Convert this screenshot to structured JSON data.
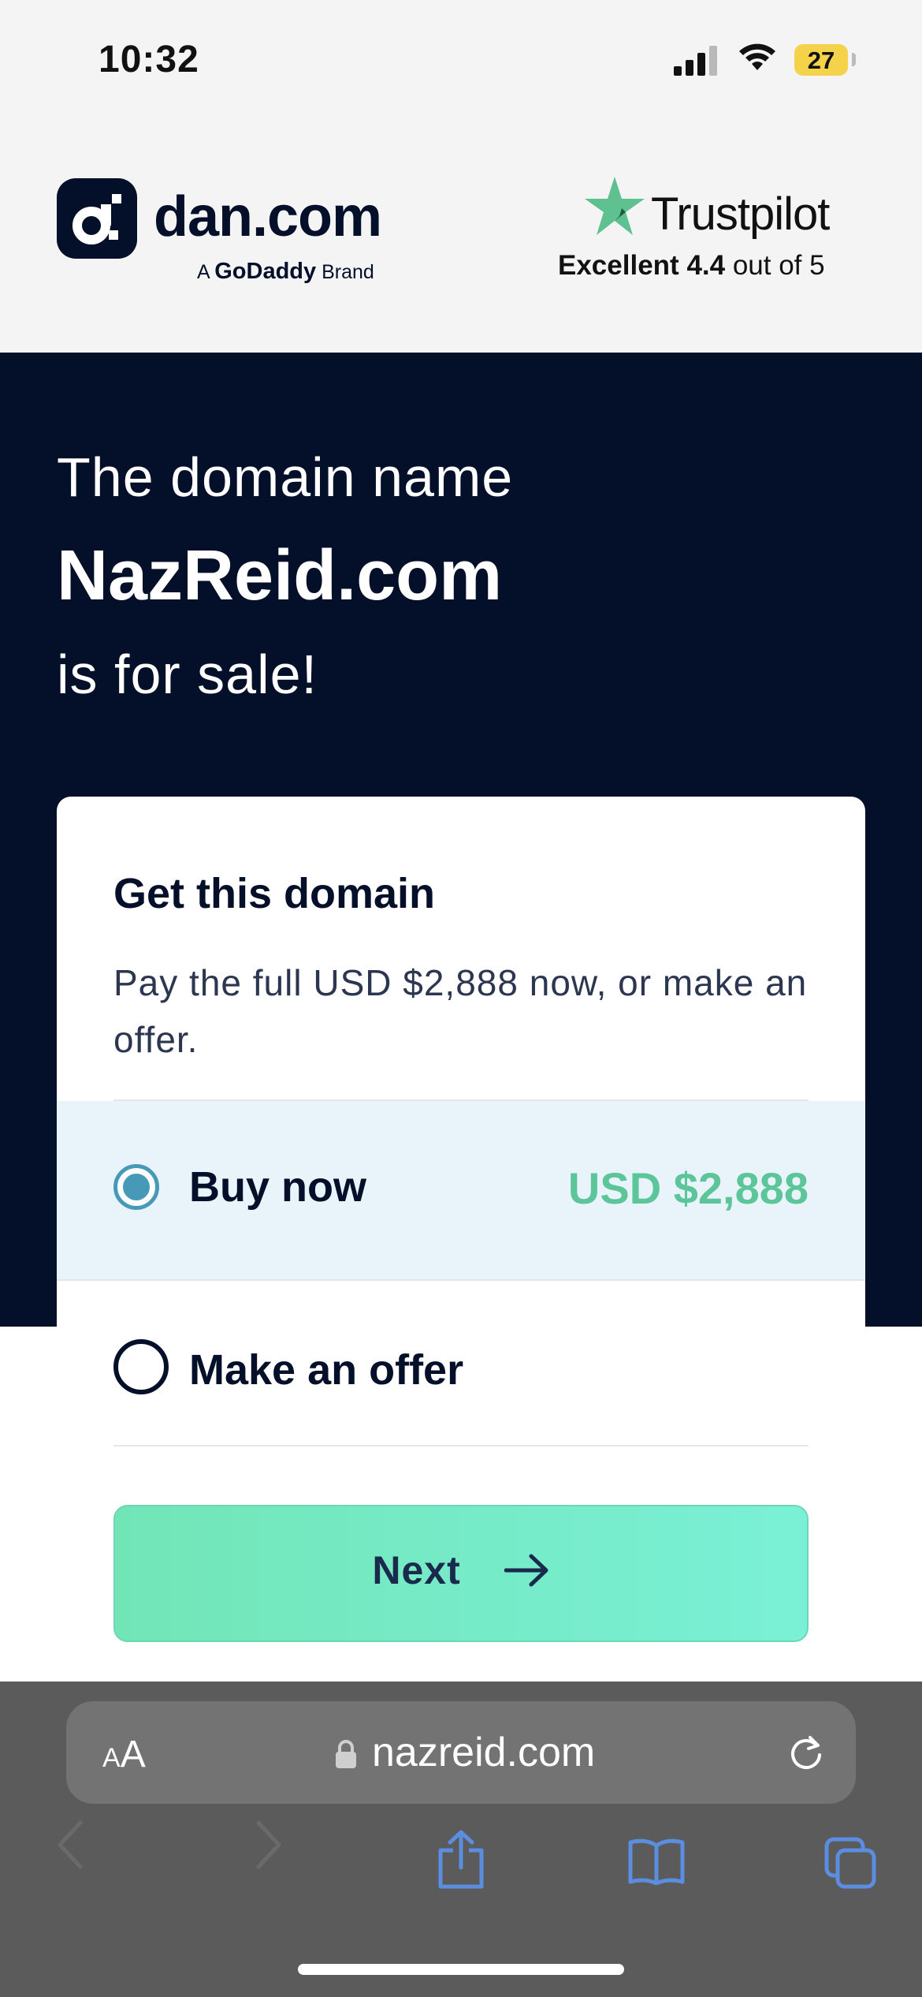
{
  "status": {
    "time": "10:32",
    "battery": "27"
  },
  "header": {
    "logo_text": "dan.com",
    "logo_sub_prefix": "A",
    "logo_sub_brand": "GoDaddy",
    "logo_sub_suffix": "Brand",
    "trustpilot": {
      "name": "Trustpilot",
      "rating_word": "Excellent",
      "score": "4.4",
      "suffix": "out of 5"
    }
  },
  "hero": {
    "line1": "The domain name",
    "domain": "NazReid.com",
    "line3": "is for sale!"
  },
  "card": {
    "title": "Get this domain",
    "description": "Pay the full USD $2,888 now, or make an offer.",
    "options": [
      {
        "label": "Buy now",
        "price": "USD $2,888",
        "selected": true
      },
      {
        "label": "Make an offer",
        "selected": false
      }
    ],
    "next_label": "Next"
  },
  "browser": {
    "aa_small": "A",
    "aa_big": "A",
    "url": "nazreid.com"
  },
  "colors": {
    "navy": "#04102a",
    "accent_green": "#5cc599",
    "radio_blue": "#4799b8",
    "selected_bg": "#e9f4fa"
  }
}
